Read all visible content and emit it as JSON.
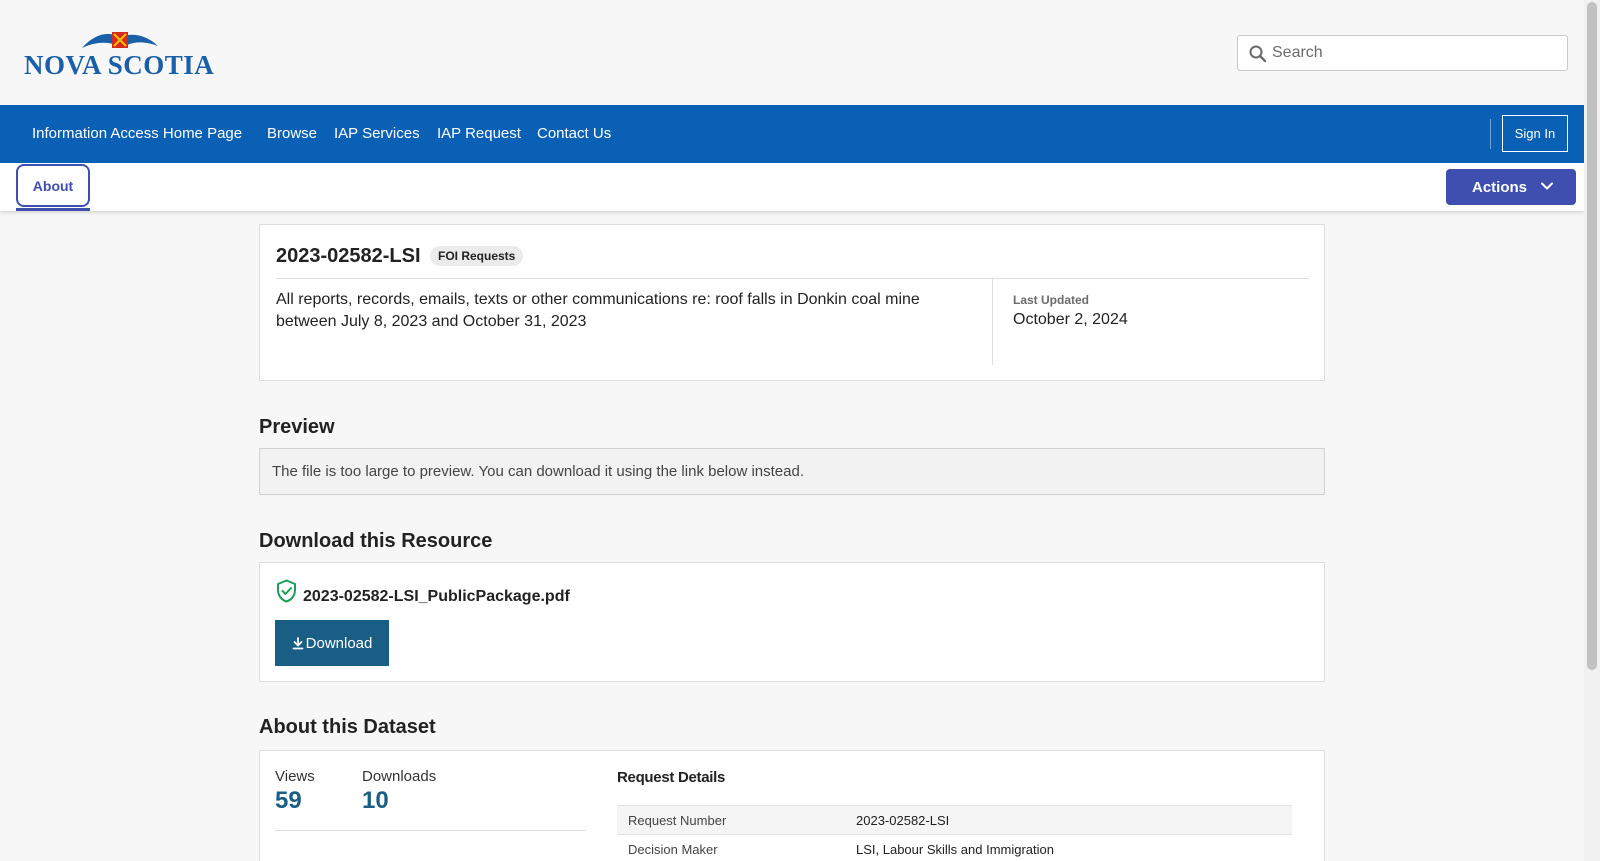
{
  "header": {
    "logo_text": "NOVA SCOTIA",
    "search_placeholder": "Search"
  },
  "nav": {
    "items": [
      "Information Access Home Page",
      "Browse",
      "IAP Services",
      "IAP Request",
      "Contact Us"
    ],
    "sign_in": "Sign In"
  },
  "subnav": {
    "tab_about": "About",
    "actions": "Actions"
  },
  "dataset": {
    "title": "2023-02582-LSI",
    "badge": "FOI Requests",
    "description": "All reports, records, emails, texts or other communications re: roof falls in Donkin coal mine between July 8, 2023 and October 31, 2023",
    "last_updated_label": "Last Updated",
    "last_updated_value": "October 2, 2024"
  },
  "preview": {
    "heading": "Preview",
    "message": "The file is too large to preview. You can download it using the link below instead."
  },
  "download": {
    "heading": "Download this Resource",
    "filename": "2023-02582-LSI_PublicPackage.pdf",
    "button": "Download"
  },
  "about": {
    "heading": "About this Dataset",
    "views_label": "Views",
    "views_value": "59",
    "downloads_label": "Downloads",
    "downloads_value": "10",
    "request_details_title": "Request Details",
    "rows": [
      {
        "key": "Request Number",
        "value": "2023-02582-LSI"
      },
      {
        "key": "Decision Maker",
        "value": "LSI, Labour Skills and Immigration"
      }
    ]
  },
  "colors": {
    "nav_blue": "#0a60b5",
    "accent_indigo": "#3f4fb0",
    "download_teal": "#1b5e85",
    "verified_green": "#1a9e58"
  }
}
